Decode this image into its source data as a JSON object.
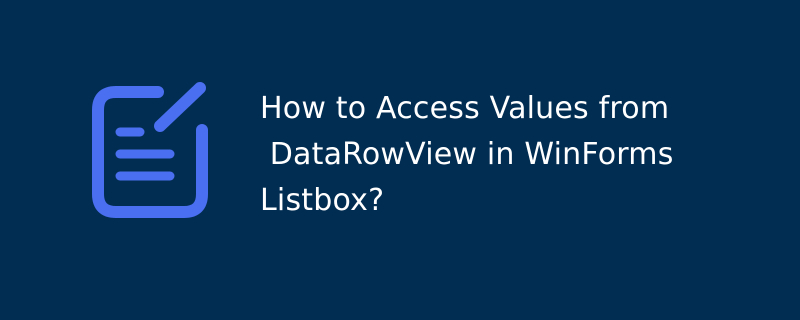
{
  "background_color": "#022d52",
  "accent_color": "#4a6ff0",
  "icon": "document-edit-icon",
  "title_lines": [
    "How to Access Values from",
    " DataRowView in WinForms",
    "Listbox?"
  ]
}
